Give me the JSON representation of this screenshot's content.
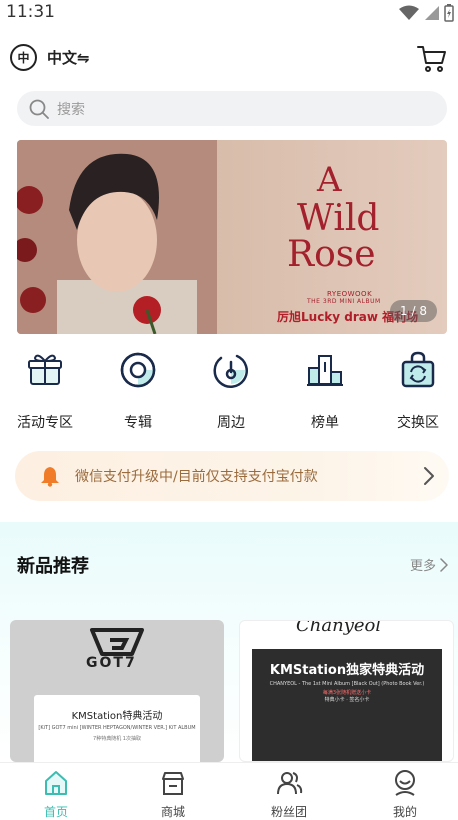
{
  "status_bar": {
    "time": "11:31"
  },
  "header": {
    "lang_icon_text": "中",
    "lang_label": "中文⇋"
  },
  "search": {
    "placeholder": "搜索"
  },
  "banner": {
    "title_line1": "A",
    "title_line2": "Wild",
    "title_line3": "Rose",
    "artist": "RYEOWOOK",
    "album": "THE 3RD MINI ALBUM",
    "caption": "厉旭Lucky draw 福利场",
    "pager": "1 / 8"
  },
  "categories": [
    {
      "label": "活动专区",
      "icon": "gift-icon"
    },
    {
      "label": "专辑",
      "icon": "disc-icon"
    },
    {
      "label": "周边",
      "icon": "merch-icon"
    },
    {
      "label": "榜单",
      "icon": "podium-icon"
    },
    {
      "label": "交换区",
      "icon": "exchange-bag-icon"
    }
  ],
  "notice": {
    "text": "微信支付升级中/目前仅支持支付宝付款"
  },
  "new_products": {
    "title": "新品推荐",
    "more": "更多",
    "cards": [
      {
        "brand": "GOT7",
        "title": "KMStation特典活动",
        "subtitle": "[KiT] GOT7 mini [WINTER HEPTAGON/WINTER VER.] KiT ALBUM",
        "note": "7种特典随机 1次抽取"
      },
      {
        "brand": "Chanyeol",
        "title": "KMStation独家特典活动",
        "subtitle": "CHANYEOL - The 1st Mini Album [Black Out] (Photo Book Ver.)",
        "note": "每满3张随机赠送小卡",
        "note2": "特典小卡 · 签名小卡"
      }
    ]
  },
  "tabbar": [
    {
      "label": "首页",
      "icon": "home-icon",
      "active": true
    },
    {
      "label": "商城",
      "icon": "store-icon",
      "active": false
    },
    {
      "label": "粉丝团",
      "icon": "fans-icon",
      "active": false
    },
    {
      "label": "我的",
      "icon": "profile-icon",
      "active": false
    }
  ],
  "colors": {
    "accent": "#3dbdb2",
    "banner_red": "#a3202d",
    "notice_text": "#9a6b3d"
  }
}
